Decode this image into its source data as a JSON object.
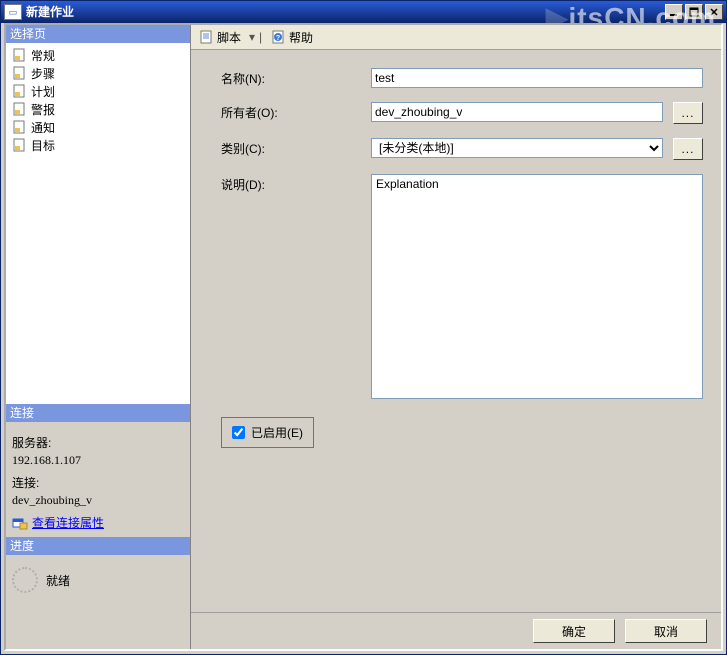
{
  "window": {
    "title": "新建作业"
  },
  "watermark": "itsCN.com",
  "sidebar": {
    "select_page_label": "选择页",
    "pages": [
      {
        "label": "常规",
        "icon": "page"
      },
      {
        "label": "步骤",
        "icon": "page"
      },
      {
        "label": "计划",
        "icon": "page"
      },
      {
        "label": "警报",
        "icon": "page"
      },
      {
        "label": "通知",
        "icon": "page"
      },
      {
        "label": "目标",
        "icon": "page"
      }
    ],
    "connection": {
      "header": "连接",
      "server_label": "服务器:",
      "server_value": "192.168.1.107",
      "conn_label": "连接:",
      "conn_value": "dev_zhoubing_v",
      "view_props": "查看连接属性"
    },
    "progress": {
      "header": "进度",
      "status": "就绪"
    }
  },
  "toolbar": {
    "script": "脚本",
    "help": "帮助"
  },
  "form": {
    "name_label": "名称(N):",
    "name_value": "test",
    "owner_label": "所有者(O):",
    "owner_value": "dev_zhoubing_v",
    "category_label": "类别(C):",
    "category_value": "[未分类(本地)]",
    "description_label": "说明(D):",
    "description_value": "Explanation",
    "browse": "...",
    "enabled_label": "已启用(E)",
    "enabled_checked": true
  },
  "buttons": {
    "ok": "确定",
    "cancel": "取消"
  }
}
